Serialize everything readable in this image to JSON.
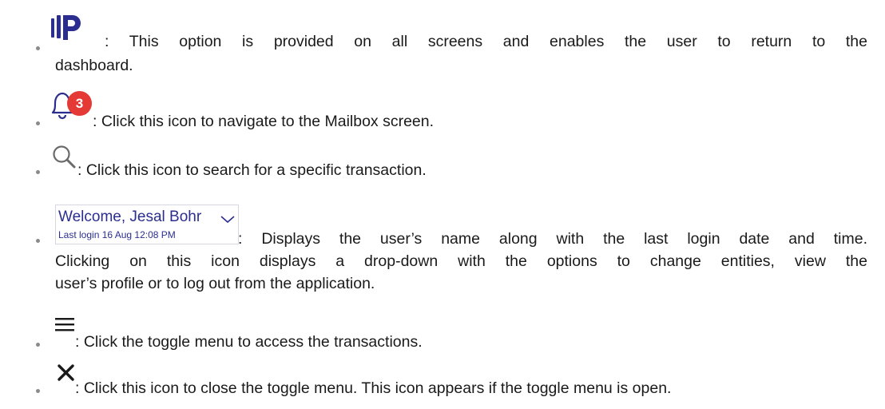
{
  "items": [
    {
      "icon": "dashboard-logo-icon",
      "line1": ": This option is provided on all screens and enables the user to return to the",
      "line2": "dashboard."
    },
    {
      "icon": "bell-icon",
      "badge_count": "3",
      "line1": ": Click this icon to navigate to the Mailbox screen."
    },
    {
      "icon": "search-icon",
      "line1": ": Click this icon to search for a specific transaction."
    },
    {
      "icon": "chevron-down-icon",
      "welcome_text": "Welcome, Jesal Bohr",
      "last_login": "Last login 16 Aug 12:08 PM",
      "line1": ": Displays the user’s name along with the last login date and time.",
      "line2": "Clicking on this icon displays a drop-down with the options to change entities, view the",
      "line3": "user’s profile or to log out from the application."
    },
    {
      "icon": "hamburger-menu-icon",
      "line1": ": Click the toggle menu to access the transactions."
    },
    {
      "icon": "close-icon",
      "line1": ": Click this icon to close the toggle menu. This icon appears if the toggle menu is open."
    }
  ],
  "colors": {
    "text": "#1a1a1a",
    "brand_blue": "#2b2e8f",
    "badge_red": "#e53935",
    "icon_gray": "#6a6a6a"
  }
}
